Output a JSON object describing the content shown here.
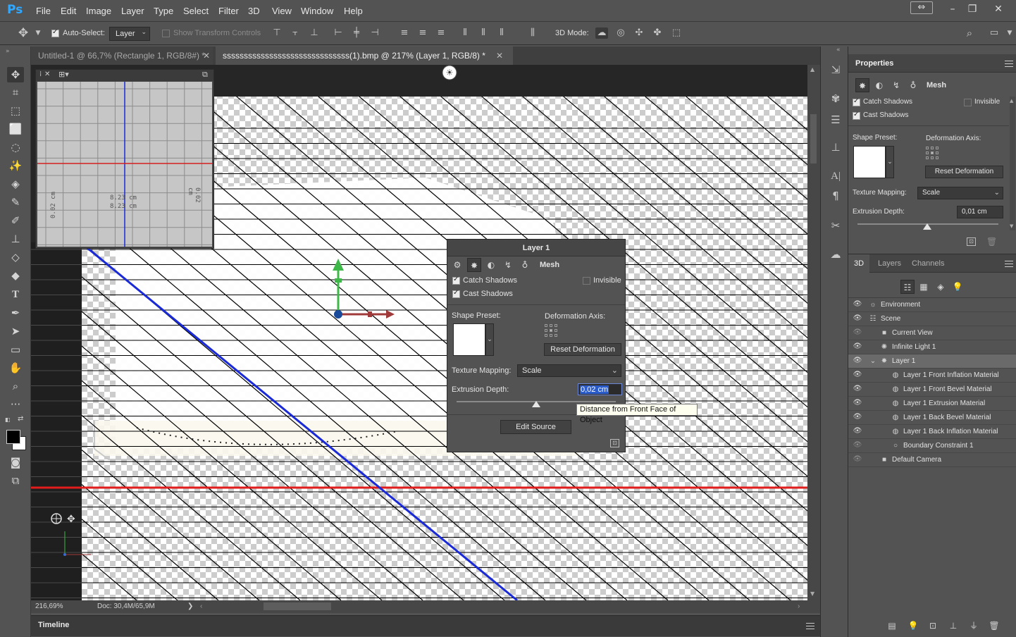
{
  "app": {
    "logo": "Ps"
  },
  "menu": [
    "File",
    "Edit",
    "Image",
    "Layer",
    "Type",
    "Select",
    "Filter",
    "3D",
    "View",
    "Window",
    "Help"
  ],
  "options_bar": {
    "auto_select_label": "Auto-Select:",
    "auto_select_checked": true,
    "auto_select_value": "Layer",
    "show_transform_label": "Show Transform Controls",
    "show_transform_checked": false,
    "mode_3d_label": "3D Mode:"
  },
  "tabs": [
    {
      "label": "Untitled-1 @ 66,7% (Rectangle 1, RGB/8#) *",
      "active": false
    },
    {
      "label": "ssssssssssssssssssssssssssssss(1).bmp @ 217% (Layer 1, RGB/8) *",
      "active": true
    }
  ],
  "navigator": {
    "label_left": "0.02 cm",
    "label_right": "0.02 cm",
    "label_center_1": "8.23 cm",
    "label_center_2": "8.23 cm"
  },
  "status": {
    "zoom": "216,69%",
    "doc": "Doc: 30,4M/65,9M",
    "arrow": "❯"
  },
  "timeline": {
    "label": "Timeline"
  },
  "floating_properties": {
    "title": "Layer 1",
    "tab_mesh": "Mesh",
    "catch_shadows": "Catch Shadows",
    "catch_shadows_checked": true,
    "cast_shadows": "Cast Shadows",
    "cast_shadows_checked": true,
    "invisible": "Invisible",
    "invisible_checked": false,
    "shape_preset": "Shape Preset:",
    "deformation_axis": "Deformation Axis:",
    "reset_deformation": "Reset Deformation",
    "texture_mapping": "Texture Mapping:",
    "texture_mapping_value": "Scale",
    "extrusion_depth": "Extrusion Depth:",
    "extrusion_depth_value": "0,02 cm",
    "edit_source": "Edit Source",
    "tooltip": "Distance from Front Face of Object"
  },
  "properties_panel": {
    "title": "Properties",
    "tab_mesh": "Mesh",
    "catch_shadows": "Catch Shadows",
    "catch_shadows_checked": true,
    "cast_shadows": "Cast Shadows",
    "cast_shadows_checked": true,
    "invisible": "Invisible",
    "invisible_checked": false,
    "shape_preset": "Shape Preset:",
    "deformation_axis": "Deformation Axis:",
    "reset_deformation": "Reset Deformation",
    "texture_mapping": "Texture Mapping:",
    "texture_mapping_value": "Scale",
    "extrusion_depth": "Extrusion Depth:",
    "extrusion_depth_value": "0,01 cm"
  },
  "d3_panel": {
    "tabs": [
      "3D",
      "Layers",
      "Channels"
    ],
    "tree": [
      {
        "label": "Environment",
        "icon": "environment-icon",
        "indent": 0,
        "visible": true
      },
      {
        "label": "Scene",
        "icon": "scene-icon",
        "indent": 0,
        "visible": true
      },
      {
        "label": "Current View",
        "icon": "camera-icon",
        "indent": 1,
        "visible": false
      },
      {
        "label": "Infinite Light 1",
        "icon": "light-icon",
        "indent": 1,
        "visible": true
      },
      {
        "label": "Layer 1",
        "icon": "mesh-icon",
        "indent": 1,
        "visible": true,
        "selected": true,
        "expanded": true
      },
      {
        "label": "Layer 1 Front Inflation Material",
        "icon": "material-icon",
        "indent": 2,
        "visible": true
      },
      {
        "label": "Layer 1 Front Bevel Material",
        "icon": "material-icon",
        "indent": 2,
        "visible": true
      },
      {
        "label": "Layer 1 Extrusion Material",
        "icon": "material-icon",
        "indent": 2,
        "visible": true
      },
      {
        "label": "Layer 1 Back Bevel Material",
        "icon": "material-icon",
        "indent": 2,
        "visible": true
      },
      {
        "label": "Layer 1 Back Inflation Material",
        "icon": "material-icon",
        "indent": 2,
        "visible": true
      },
      {
        "label": "Boundary Constraint 1",
        "icon": "constraint-icon",
        "indent": 2,
        "visible": false
      },
      {
        "label": "Default Camera",
        "icon": "camera-icon",
        "indent": 1,
        "visible": false
      }
    ]
  },
  "colors": {
    "guide_red": "#e21b1b",
    "guide_blue": "#1a2ad6",
    "widget_green": "#3fb84a",
    "widget_red": "#a03a3a",
    "selection_blue": "#2a5ccc"
  }
}
